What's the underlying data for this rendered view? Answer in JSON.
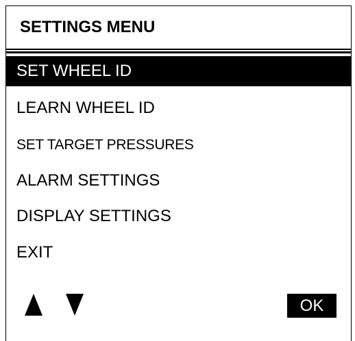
{
  "header": {
    "title": "SETTINGS MENU"
  },
  "menu": {
    "items": [
      {
        "label": "SET WHEEL ID",
        "selected": true
      },
      {
        "label": "LEARN WHEEL ID",
        "selected": false
      },
      {
        "label": "SET TARGET PRESSURES",
        "selected": false
      },
      {
        "label": "ALARM SETTINGS",
        "selected": false
      },
      {
        "label": "DISPLAY SETTINGS",
        "selected": false
      },
      {
        "label": "EXIT",
        "selected": false
      }
    ]
  },
  "controls": {
    "up_icon": "up-triangle-icon",
    "down_icon": "down-triangle-icon",
    "ok_label": "OK"
  },
  "colors": {
    "foreground": "#000000",
    "background": "#ffffff",
    "highlight_text": "#ffffff"
  }
}
